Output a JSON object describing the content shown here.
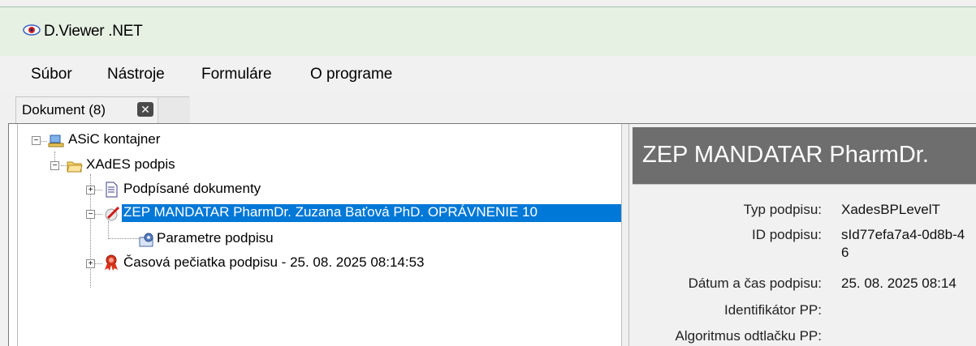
{
  "app": {
    "title": "D.Viewer .NET",
    "icon": "eye-icon"
  },
  "menu": {
    "items": [
      "Súbor",
      "Nástroje",
      "Formuláre",
      "O programe"
    ]
  },
  "tabs": [
    {
      "label": "Dokument (8)",
      "close_icon": "close-icon"
    }
  ],
  "tree": {
    "nodes": [
      {
        "label": "ASiC kontajner",
        "icon": "container-icon",
        "expander": "−"
      },
      {
        "label": "XAdES podpis",
        "icon": "folder-open-icon",
        "expander": "−"
      },
      {
        "label": "Podpísané dokumenty",
        "icon": "document-icon",
        "expander": "+"
      },
      {
        "label": "ZEP MANDATAR PharmDr. Zuzana Baťová PhD. OPRÁVNENIE 10",
        "icon": "signature-pen-icon",
        "expander": "−",
        "selected": true
      },
      {
        "label": "Parametre podpisu",
        "icon": "settings-icon"
      },
      {
        "label": "Časová pečiatka podpisu - 25. 08. 2025 08:14:53",
        "icon": "timestamp-seal-icon",
        "expander": "+"
      }
    ]
  },
  "details": {
    "header": "ZEP MANDATAR PharmDr.",
    "rows": [
      {
        "label": "Typ podpisu:",
        "value": "XadesBPLevelT"
      },
      {
        "label": "ID podpisu:",
        "value": "sId77efa7a4-0d8b-4",
        "value2": "6"
      },
      {
        "label": "Dátum a čas podpisu:",
        "value": "25. 08. 2025 08:14"
      },
      {
        "label": "Identifikátor PP:",
        "value": ""
      },
      {
        "label": "Algoritmus odtlačku PP:",
        "value": ""
      }
    ]
  },
  "colors": {
    "titlebar": "#e6f1e3",
    "selection": "#0078d7",
    "header_bg": "#6e6e6e"
  }
}
